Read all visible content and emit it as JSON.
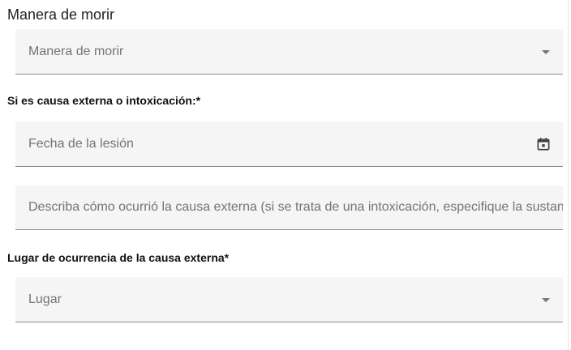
{
  "section": {
    "title": "Manera de morir"
  },
  "manner_field": {
    "placeholder": "Manera de morir",
    "icon": "chevron-down-icon"
  },
  "external_cause": {
    "heading": "Si es causa externa o intoxicación:*",
    "date_field": {
      "placeholder": "Fecha de la lesión",
      "icon": "calendar-icon"
    },
    "description_field": {
      "placeholder": "Describa cómo ocurrió la causa externa (si se trata de una intoxicación, especifique la sustancia)"
    }
  },
  "location": {
    "heading": "Lugar de ocurrencia de la causa externa*",
    "field": {
      "placeholder": "Lugar",
      "icon": "chevron-down-icon"
    }
  },
  "colors": {
    "field_background": "#f5f5f5",
    "field_underline": "#8c8c8c",
    "placeholder_text": "#747474",
    "icon": "#757575"
  }
}
